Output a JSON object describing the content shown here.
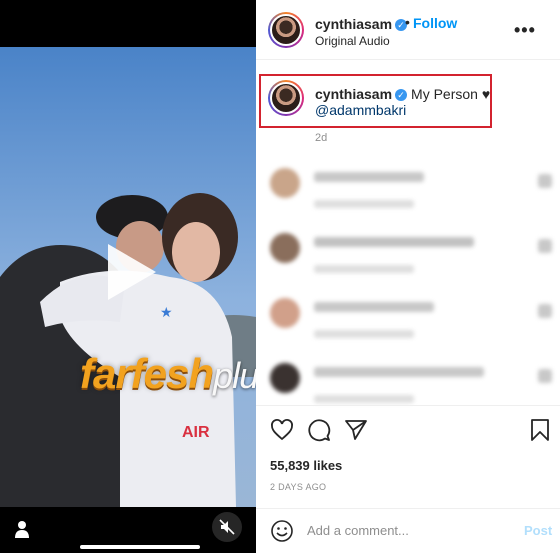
{
  "header": {
    "username": "cynthiasam",
    "separator": "•",
    "follow_label": "Follow",
    "subtitle": "Original Audio",
    "more_label": "•••"
  },
  "caption": {
    "username": "cynthiasam",
    "text": "My Person ♥",
    "mention": "@adammbakri",
    "time": "2d"
  },
  "comments": [
    {
      "avatar_color": "#c9a58a",
      "text_color": "#9a9a9a",
      "text_width": 110
    },
    {
      "avatar_color": "#8a6e5c",
      "text_color": "#8f8f8f",
      "text_width": 160
    },
    {
      "avatar_color": "#d1a08a",
      "text_color": "#9a9a9a",
      "text_width": 120
    },
    {
      "avatar_color": "#3a3230",
      "text_color": "#9a9a9a",
      "text_width": 170
    }
  ],
  "watermark": {
    "part1": "farfesh",
    "part2": "plus.com"
  },
  "stats": {
    "likes": "55,839 likes",
    "ago": "2 DAYS AGO"
  },
  "add_comment": {
    "placeholder": "Add a comment...",
    "post_label": "Post"
  },
  "colors": {
    "accent": "#0095f6",
    "highlight_box": "#d3232f",
    "verified": "#3897f0"
  }
}
